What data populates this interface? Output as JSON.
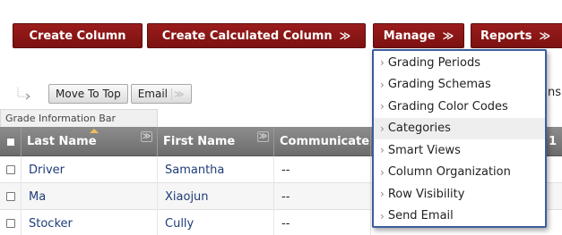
{
  "toolbar": {
    "create_column": "Create Column",
    "create_calc_column": "Create Calculated Column",
    "manage": "Manage",
    "reports": "Reports",
    "chevron": "≫"
  },
  "actions": {
    "move_to_top": "Move To Top",
    "email": "Email",
    "email_chevron": "≫"
  },
  "info_bar": {
    "label": "Grade Information Bar"
  },
  "grid": {
    "columns": [
      "Last Name",
      "First Name",
      "Communicate"
    ],
    "rows": [
      {
        "last": "Driver",
        "first": "Samantha",
        "comm": "--"
      },
      {
        "last": "Ma",
        "first": "Xiaojun",
        "comm": "--"
      },
      {
        "last": "Stocker",
        "first": "Cully",
        "comm": "--"
      }
    ]
  },
  "manage_menu": {
    "items": [
      "Grading Periods",
      "Grading Schemas",
      "Grading Color Codes",
      "Categories",
      "Smart Views",
      "Column Organization",
      "Row Visibility",
      "Send Email"
    ],
    "active_index": 3,
    "caret": "›"
  },
  "partial_labels": {
    "right_text": "ns",
    "right_digit": "1"
  },
  "colors": {
    "brand": "#8b1414",
    "header": "#7a7a7a",
    "menu_border": "#3c5d9e",
    "link": "#1e3c78"
  },
  "icons": [
    "move-arrow-icon",
    "chevron-down-icon",
    "sort-icon",
    "checkbox-icon",
    "caret-right-icon"
  ]
}
